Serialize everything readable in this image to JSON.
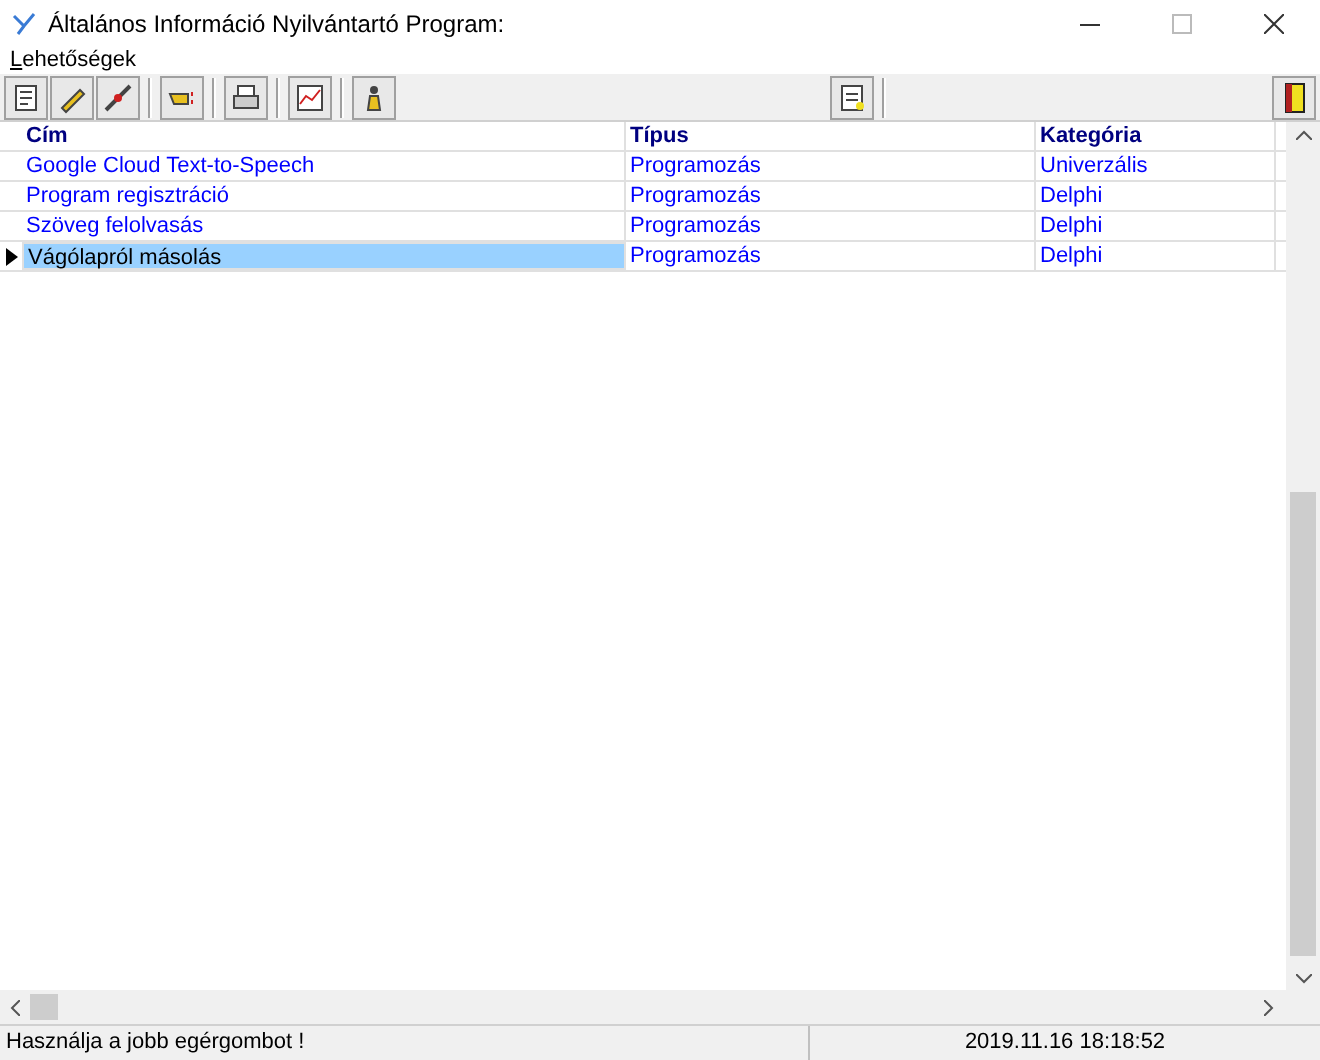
{
  "window": {
    "title": "Általános Információ Nyilvántartó Program:"
  },
  "menu": [
    "Lehetőségek"
  ],
  "table": {
    "columns": [
      "Cím",
      "Típus",
      "Kategória"
    ],
    "rows": [
      {
        "cells": [
          "Google Cloud Text-to-Speech",
          "Programozás",
          "Univerzális"
        ],
        "selected": false
      },
      {
        "cells": [
          "Program regisztráció",
          "Programozás",
          "Delphi"
        ],
        "selected": false
      },
      {
        "cells": [
          "Szöveg felolvasás",
          "Programozás",
          "Delphi"
        ],
        "selected": false
      },
      {
        "cells": [
          "Vágólapról másolás",
          "Programozás",
          "Delphi"
        ],
        "selected": true
      }
    ]
  },
  "status_bar": {
    "message": "Használja a jobb egérgombot !",
    "datetime": "2019.11.16 18:18:52"
  }
}
